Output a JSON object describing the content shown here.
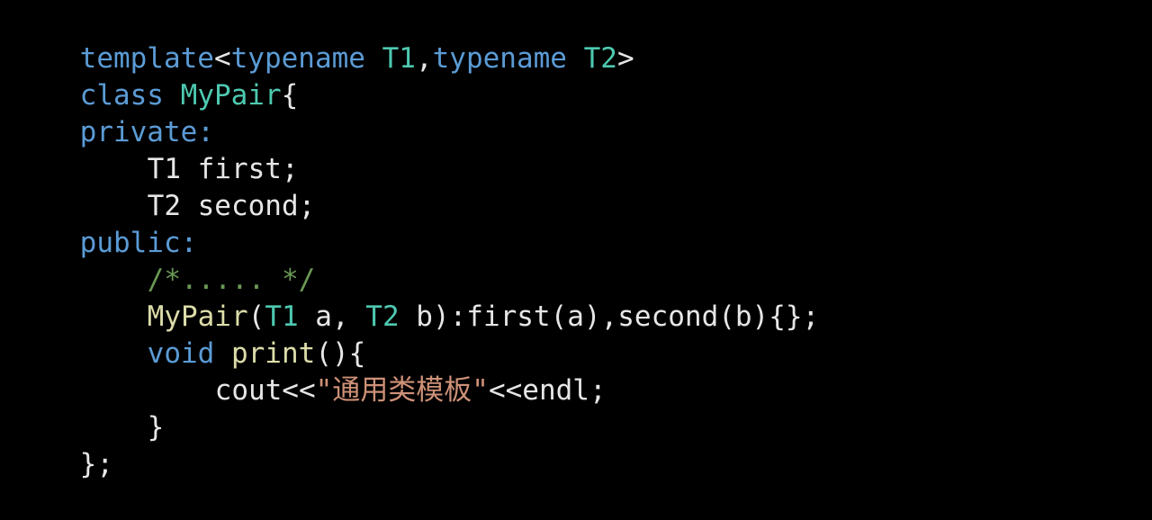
{
  "code": {
    "colors": {
      "background": "#000000",
      "keyword": "#5b9bd5",
      "type": "#4ec9b0",
      "function": "#dcdcaa",
      "plain": "#e6e6e6",
      "string": "#ce9178",
      "comment": "#6a9955"
    },
    "lines": [
      [
        {
          "text": "template",
          "kind": "kw"
        },
        {
          "text": "<",
          "kind": "plain"
        },
        {
          "text": "typename",
          "kind": "kw"
        },
        {
          "text": " ",
          "kind": "plain"
        },
        {
          "text": "T1",
          "kind": "type"
        },
        {
          "text": ",",
          "kind": "plain"
        },
        {
          "text": "typename",
          "kind": "kw"
        },
        {
          "text": " ",
          "kind": "plain"
        },
        {
          "text": "T2",
          "kind": "type"
        },
        {
          "text": ">",
          "kind": "plain"
        }
      ],
      [
        {
          "text": "class",
          "kind": "kw"
        },
        {
          "text": " ",
          "kind": "plain"
        },
        {
          "text": "MyPair",
          "kind": "type"
        },
        {
          "text": "{",
          "kind": "plain"
        }
      ],
      [
        {
          "text": "private:",
          "kind": "kw"
        }
      ],
      [
        {
          "text": "T1 first;",
          "kind": "plain"
        }
      ],
      [
        {
          "text": "T2 second;",
          "kind": "plain"
        }
      ],
      [
        {
          "text": "public:",
          "kind": "kw"
        }
      ],
      [
        {
          "text": "/*..... */",
          "kind": "cmt"
        }
      ],
      [
        {
          "text": "MyPair",
          "kind": "fn"
        },
        {
          "text": "(",
          "kind": "plain"
        },
        {
          "text": "T1",
          "kind": "type"
        },
        {
          "text": " a, ",
          "kind": "plain"
        },
        {
          "text": "T2",
          "kind": "type"
        },
        {
          "text": " b):first(a),second(b){};",
          "kind": "plain"
        }
      ],
      [
        {
          "text": "void",
          "kind": "kw"
        },
        {
          "text": " ",
          "kind": "plain"
        },
        {
          "text": "print",
          "kind": "fn"
        },
        {
          "text": "(){",
          "kind": "plain"
        }
      ],
      [
        {
          "text": "cout<<",
          "kind": "plain"
        },
        {
          "text": "\"通用类模板\"",
          "kind": "str"
        },
        {
          "text": "<<endl;",
          "kind": "plain"
        }
      ],
      [
        {
          "text": "}",
          "kind": "plain"
        }
      ],
      [
        {
          "text": "};",
          "kind": "plain"
        }
      ]
    ]
  }
}
